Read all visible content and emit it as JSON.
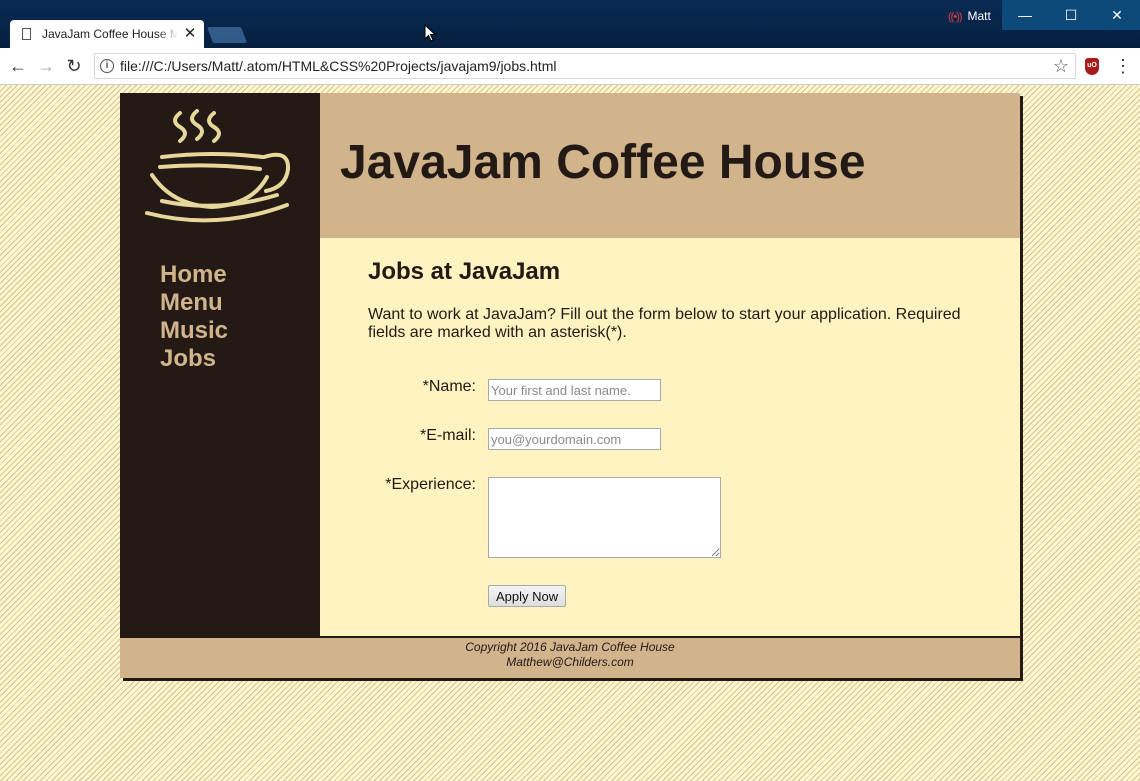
{
  "browser": {
    "tab_title": "JavaJam Coffee House M",
    "tab_close": "✕",
    "profile_name": "Matt",
    "url": "file:///C:/Users/Matt/.atom/HTML&CSS%20Projects/javajam9/jobs.html",
    "icons": {
      "back": "back-arrow-icon",
      "forward": "forward-arrow-icon",
      "reload": "reload-icon",
      "info": "info-icon",
      "star": "star-icon",
      "extension": "ublock-icon",
      "menu": "kebab-menu-icon"
    },
    "window_buttons": {
      "minimize": "—",
      "maximize": "☐",
      "close": "✕"
    }
  },
  "site": {
    "title": "JavaJam Coffee House",
    "nav": [
      "Home",
      "Menu",
      "Music",
      "Jobs"
    ],
    "colors": {
      "dark": "#231915",
      "tan": "#d2b48c",
      "cream": "#fdf3c0"
    }
  },
  "content": {
    "heading": "Jobs at JavaJam",
    "intro": "Want to work at JavaJam? Fill out the form below to start your application. Required fields are marked with an asterisk(*).",
    "form": {
      "name_label": "*Name:",
      "name_placeholder": "Your first and last name.",
      "email_label": "*E-mail:",
      "email_placeholder": "you@yourdomain.com",
      "experience_label": "*Experience:",
      "experience_value": "",
      "submit_label": "Apply Now"
    }
  },
  "footer": {
    "copyright": "Copyright 2016 JavaJam Coffee House",
    "email": "Matthew@Childers.com"
  }
}
